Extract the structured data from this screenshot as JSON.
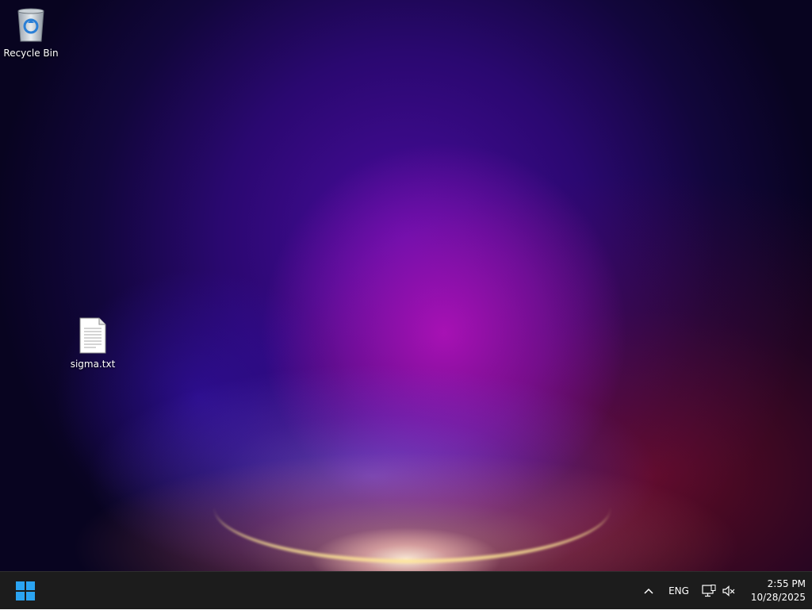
{
  "desktop": {
    "icons": [
      {
        "label": "Recycle Bin",
        "icon": "recycle-bin-icon"
      },
      {
        "label": "sigma.txt",
        "icon": "text-file-icon"
      }
    ]
  },
  "taskbar": {
    "start_icon": "windows-logo-icon",
    "tray": {
      "chevron_icon": "chevron-up-icon",
      "language": "ENG",
      "network_icon": "network-icon",
      "volume_icon": "volume-muted-icon",
      "time": "2:55 PM",
      "date": "10/28/2025"
    }
  },
  "colors": {
    "taskbar_bg": "#1c1c1c",
    "windows_blue": "#2ba4f2",
    "desktop_text": "#ffffff"
  }
}
